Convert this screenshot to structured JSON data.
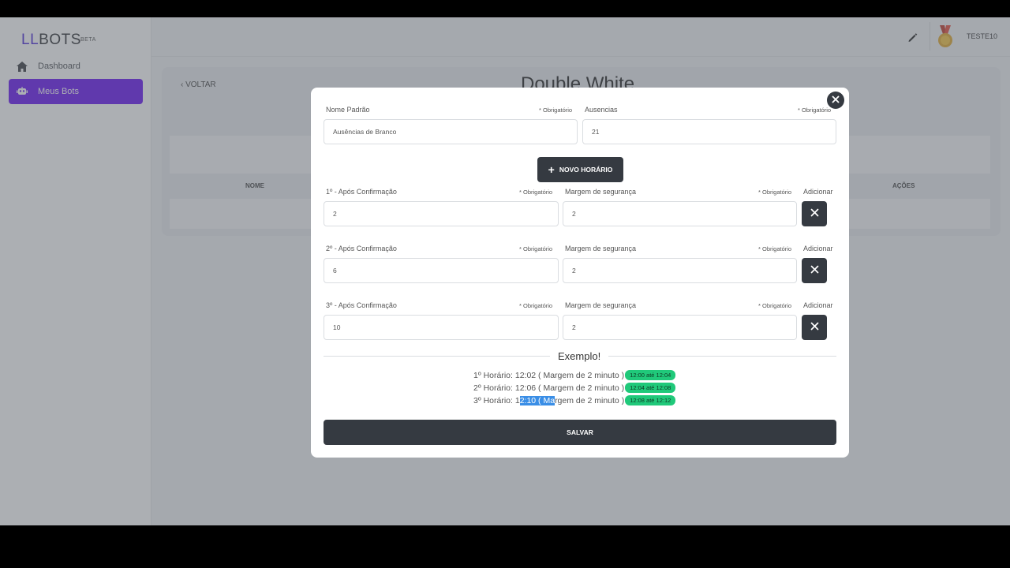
{
  "app": {
    "brand_prefix": "LL",
    "brand_suffix": "BOTS",
    "beta": "BETA"
  },
  "sidebar": {
    "items": [
      {
        "label": "Dashboard",
        "icon": "home-icon",
        "active": false
      },
      {
        "label": "Meus Bots",
        "icon": "robot-icon",
        "active": true
      }
    ]
  },
  "header": {
    "username": "TESTE10",
    "icons": [
      "pencil-icon",
      "medal-icon"
    ]
  },
  "page": {
    "back_label": "VOLTAR",
    "title": "Double White",
    "columns": {
      "name": "NOME",
      "actions": "AÇÕES"
    }
  },
  "modal": {
    "name_label": "Nome Padrão",
    "name_required": "* Obrigatório",
    "name_value": "Ausências de Branco",
    "absences_label": "Ausencias",
    "absences_required": "* Obrigatório",
    "absences_value": "21",
    "new_schedule_label": "NOVO HORÁRIO",
    "rows": [
      {
        "label": "1º - Após Confirmação",
        "required": "* Obrigatório",
        "value": "2",
        "margin_label": "Margem de segurança",
        "margin_required": "* Obrigatório",
        "margin_value": "2",
        "add_label": "Adicionar"
      },
      {
        "label": "2º - Após Confirmação",
        "required": "* Obrigatório",
        "value": "6",
        "margin_label": "Margem de segurança",
        "margin_required": "* Obrigatório",
        "margin_value": "2",
        "add_label": "Adicionar"
      },
      {
        "label": "3º - Após Confirmação",
        "required": "* Obrigatório",
        "value": "10",
        "margin_label": "Margem de segurança",
        "margin_required": "* Obrigatório",
        "margin_value": "2",
        "add_label": "Adicionar"
      }
    ],
    "example_title": "Exemplo!",
    "examples": [
      {
        "text": "1º Horário: 12:02 ( Margem de 2 minuto )",
        "badge": "12:00 até 12:04"
      },
      {
        "text": "2º Horário: 12:06 ( Margem de 2 minuto )",
        "badge": "12:04 até 12:08"
      },
      {
        "text_pre": "3º Horário: 1",
        "text_sel": "2:10 ( Ma",
        "text_post": "rgem de 2 minuto )",
        "badge": "12:08 até 12:12"
      }
    ],
    "save_label": "SALVAR"
  },
  "colors": {
    "accent": "#6613f2",
    "dark_button": "#353a41",
    "badge": "#20c97a"
  }
}
